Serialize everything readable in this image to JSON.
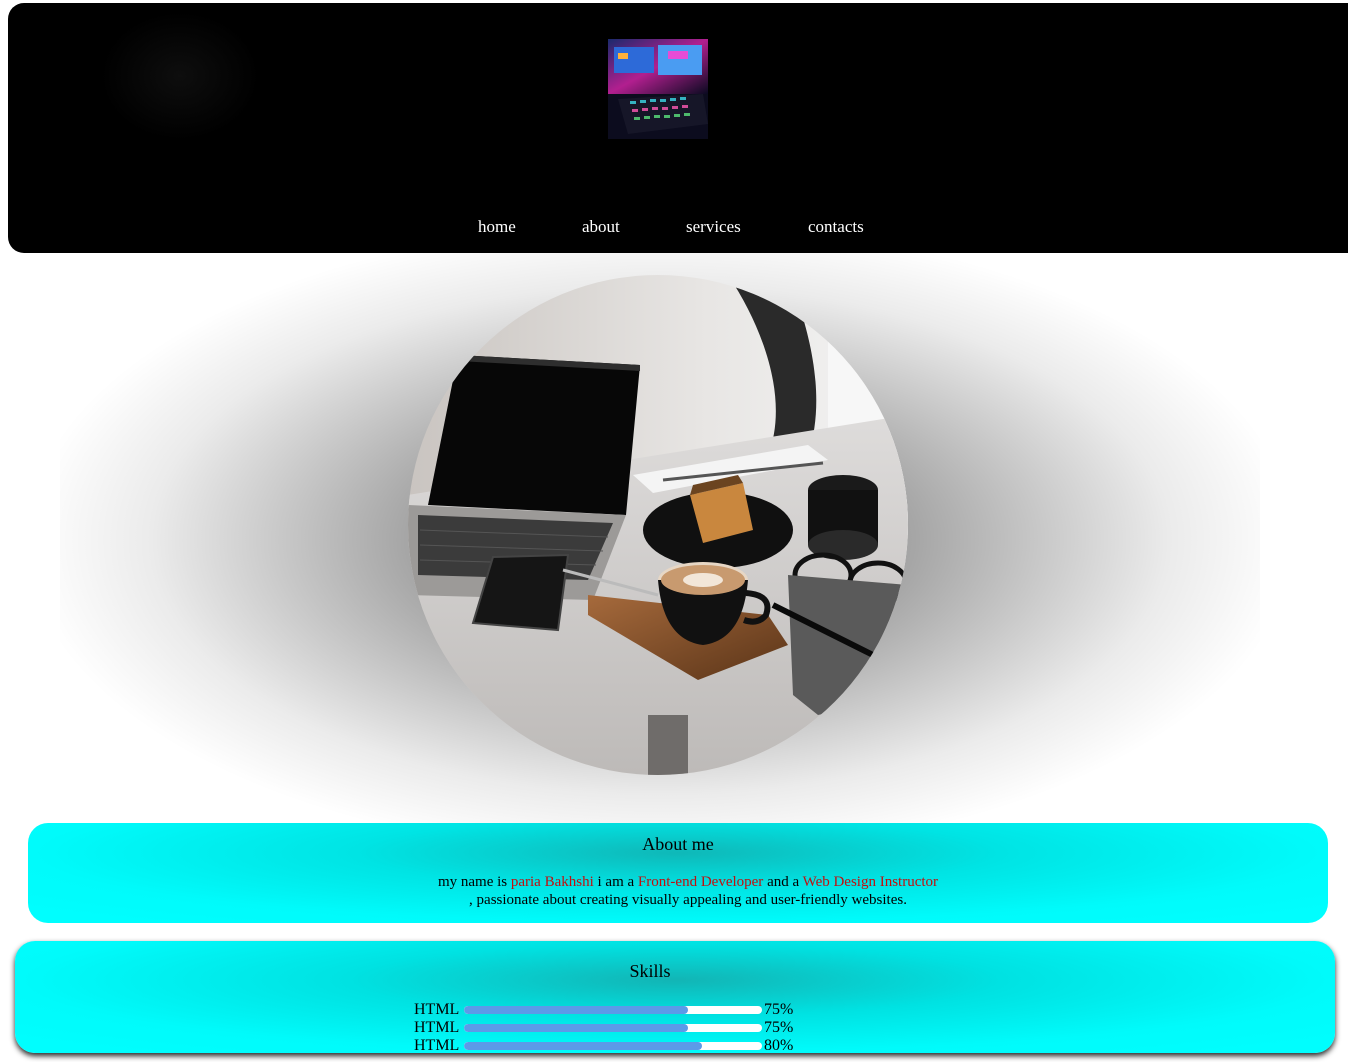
{
  "header": {
    "logo_icon": "keyboard-desk-photo",
    "nav": [
      {
        "label": "home"
      },
      {
        "label": "about"
      },
      {
        "label": "services"
      },
      {
        "label": "contacts"
      }
    ]
  },
  "hero": {
    "image_icon": "laptop-coffee-desk-photo"
  },
  "about": {
    "title": "About me",
    "text_1": "my name is ",
    "name": "paria Bakhshi",
    "text_2": " i am a ",
    "role_1": "Front-end Developer",
    "text_3": " and a ",
    "role_2": "Web Design Instructor",
    "text_4": ", passionate about creating visually appealing and user-friendly websites.",
    "highlight_color": "#c01010"
  },
  "skills": {
    "title": "Skills",
    "bar_color": "#5c9ae8",
    "items": [
      {
        "name": "HTML",
        "percent": "75%",
        "level": 0.75
      },
      {
        "name": "HTML",
        "percent": "75%",
        "level": 0.75
      },
      {
        "name": "HTML",
        "percent": "80%",
        "level": 0.8
      }
    ]
  },
  "colors": {
    "header_bg": "#000000",
    "card_bg": "#00ffff"
  }
}
